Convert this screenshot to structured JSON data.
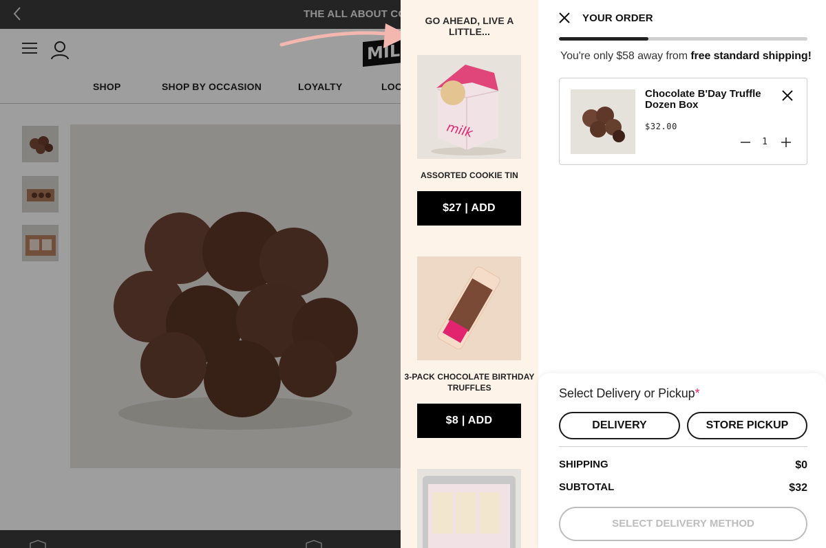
{
  "background_page": {
    "announcement": "THE ALL ABOUT COO",
    "nav": [
      "SHOP",
      "SHOP BY OCCASION",
      "LOYALTY",
      "LOC"
    ],
    "logo_text": "MIL"
  },
  "upsell": {
    "title": "GO AHEAD, LIVE A LITTLE...",
    "items": [
      {
        "name": "ASSORTED COOKIE TIN",
        "button": "$27 | ADD"
      },
      {
        "name": "3-PACK CHOCOLATE BIRTHDAY TRUFFLES",
        "button": "$8 | ADD"
      },
      {
        "name": "",
        "button": ""
      }
    ]
  },
  "cart": {
    "title": "YOUR ORDER",
    "shipping_progress": 0.36,
    "shipping_message_prefix": "You're only $58 away from ",
    "shipping_message_bold": "free standard shipping!",
    "line_item": {
      "name": "Chocolate B'Day Truffle Dozen Box",
      "price": "$32.00",
      "quantity": "1"
    },
    "delivery_label": "Select Delivery or Pickup",
    "required_mark": "*",
    "options": [
      "DELIVERY",
      "STORE PICKUP"
    ],
    "shipping_label": "SHIPPING",
    "shipping_value": "$0",
    "subtotal_label": "SUBTOTAL",
    "subtotal_value": "$32",
    "select_method_button": "SELECT DELIVERY METHOD"
  },
  "colors": {
    "upsell_bg": "#fdf3e9",
    "accent_pink": "#e2246e",
    "arrow_pink": "#f3b7b0",
    "progress_fill": "#222222"
  },
  "icons": [
    "back-chevron-icon",
    "hamburger-icon",
    "account-icon",
    "close-icon",
    "remove-icon",
    "minus-icon",
    "plus-icon",
    "shipping-box-icon"
  ]
}
